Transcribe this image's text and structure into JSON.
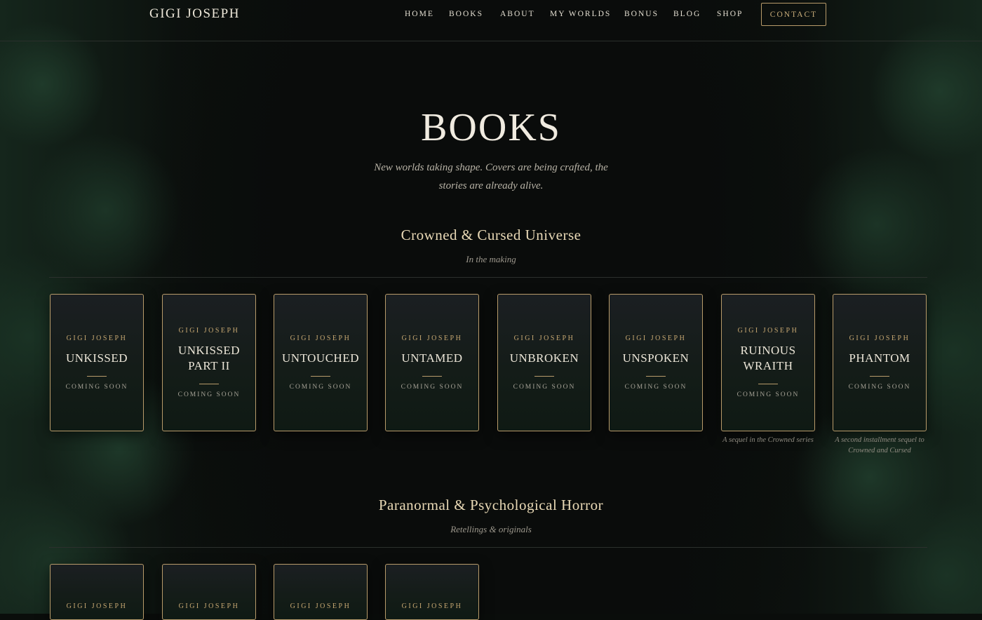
{
  "site": {
    "logo": "GIGI JOSEPH"
  },
  "nav": {
    "items": [
      "HOME",
      "BOOKS",
      "ABOUT",
      "MY WORLDS",
      "BONUS",
      "BLOG",
      "SHOP"
    ],
    "contact_label": "CONTACT"
  },
  "hero": {
    "title": "BOOKS",
    "subtitle": "New worlds taking shape. Covers are being crafted, the stories are already alive."
  },
  "sections": [
    {
      "title": "Crowned & Cursed Universe",
      "subtitle": "In the making",
      "books": [
        {
          "author": "GIGI JOSEPH",
          "title": "UNKISSED",
          "status": "COMING SOON",
          "note": ""
        },
        {
          "author": "GIGI JOSEPH",
          "title": "UNKISSED PART II",
          "status": "COMING SOON",
          "note": ""
        },
        {
          "author": "GIGI JOSEPH",
          "title": "UNTOUCHED",
          "status": "COMING SOON",
          "note": ""
        },
        {
          "author": "GIGI JOSEPH",
          "title": "UNTAMED",
          "status": "COMING SOON",
          "note": ""
        },
        {
          "author": "GIGI JOSEPH",
          "title": "UNBROKEN",
          "status": "COMING SOON",
          "note": ""
        },
        {
          "author": "GIGI JOSEPH",
          "title": "UNSPOKEN",
          "status": "COMING SOON",
          "note": ""
        },
        {
          "author": "GIGI JOSEPH",
          "title": "RUINOUS WRAITH",
          "status": "COMING SOON",
          "note": "A sequel in the Crowned series"
        },
        {
          "author": "GIGI JOSEPH",
          "title": "PHANTOM",
          "status": "COMING SOON",
          "note": "A second installment sequel to Crowned and Cursed"
        }
      ]
    },
    {
      "title": "Paranormal & Psychological Horror",
      "subtitle": "Retellings & originals",
      "books": [
        {
          "author": "GIGI JOSEPH"
        },
        {
          "author": "GIGI JOSEPH"
        },
        {
          "author": "GIGI JOSEPH"
        },
        {
          "author": "GIGI JOSEPH"
        }
      ]
    }
  ]
}
